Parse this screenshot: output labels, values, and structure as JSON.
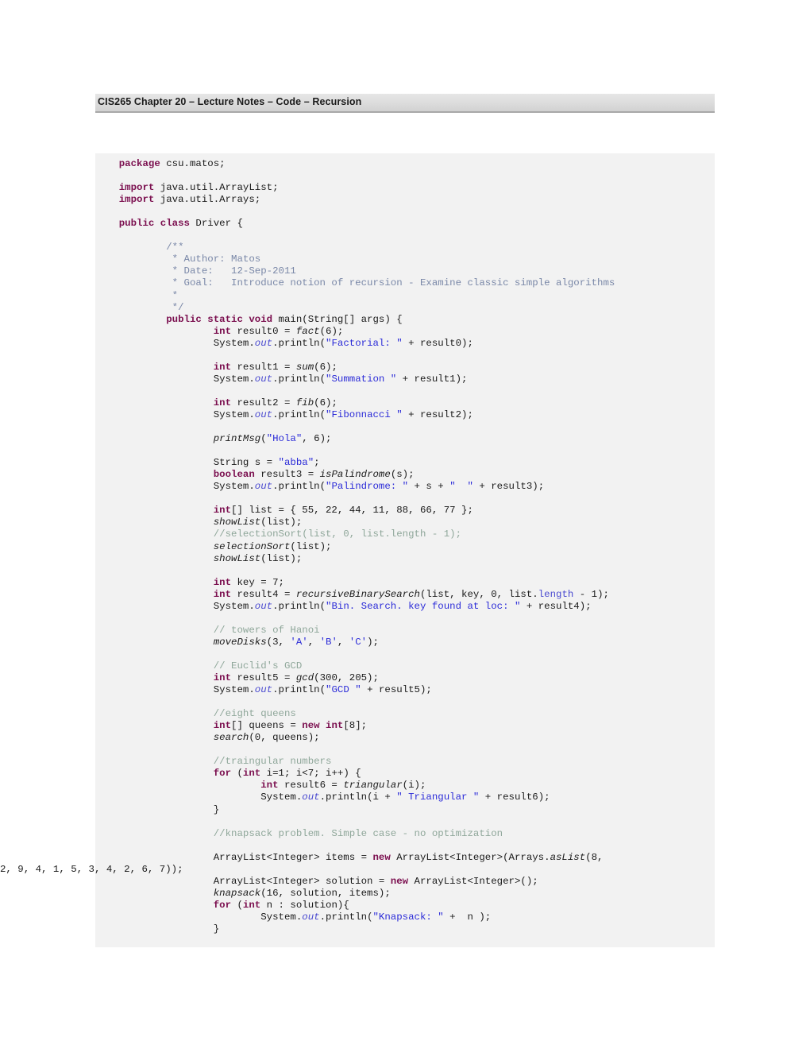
{
  "document": {
    "header": {
      "title": "CIS265  Chapter 20 – Lecture Notes – Code – Recursion"
    },
    "colors": {
      "page_background": "#ffffff",
      "header_background": "#dcdcdc",
      "header_border": "#a8a8a8",
      "code_background": "#f2f2f2",
      "keyword": "#7b0f4f",
      "string": "#2b2bd8",
      "line_comment": "#8fa79a",
      "javadoc_comment": "#7a88a8",
      "field": "#4a4ad0",
      "plain_text": "#1a1a1a"
    },
    "code": {
      "language": "java",
      "lines": [
        {
          "n": 1,
          "indent": 0,
          "tokens": [
            {
              "t": "package",
              "c": "kw"
            },
            {
              "t": " csu.matos;",
              "c": "id"
            }
          ]
        },
        {
          "n": 2,
          "indent": 0,
          "tokens": []
        },
        {
          "n": 3,
          "indent": 0,
          "tokens": [
            {
              "t": "import",
              "c": "kw"
            },
            {
              "t": " java.util.ArrayList;",
              "c": "id"
            }
          ]
        },
        {
          "n": 4,
          "indent": 0,
          "tokens": [
            {
              "t": "import",
              "c": "kw"
            },
            {
              "t": " java.util.Arrays;",
              "c": "id"
            }
          ]
        },
        {
          "n": 5,
          "indent": 0,
          "tokens": []
        },
        {
          "n": 6,
          "indent": 0,
          "tokens": [
            {
              "t": "public class",
              "c": "kw"
            },
            {
              "t": " Driver {",
              "c": "id"
            }
          ]
        },
        {
          "n": 7,
          "indent": 0,
          "tokens": []
        },
        {
          "n": 8,
          "indent": 1,
          "tokens": [
            {
              "t": "/**",
              "c": "jdoc"
            }
          ]
        },
        {
          "n": 9,
          "indent": 1,
          "tokens": [
            {
              "t": " * Author: Matos",
              "c": "jdoc"
            }
          ]
        },
        {
          "n": 10,
          "indent": 1,
          "tokens": [
            {
              "t": " * Date:   12-Sep-2011",
              "c": "jdoc"
            }
          ]
        },
        {
          "n": 11,
          "indent": 1,
          "tokens": [
            {
              "t": " * Goal:   Introduce notion of recursion - Examine classic simple algorithms",
              "c": "jdoc"
            }
          ]
        },
        {
          "n": 12,
          "indent": 1,
          "tokens": [
            {
              "t": " *",
              "c": "jdoc"
            }
          ]
        },
        {
          "n": 13,
          "indent": 1,
          "tokens": [
            {
              "t": " */",
              "c": "jdoc"
            }
          ]
        },
        {
          "n": 14,
          "indent": 1,
          "tokens": [
            {
              "t": "public static void",
              "c": "kw"
            },
            {
              "t": " main(String[] args) {",
              "c": "id"
            }
          ]
        },
        {
          "n": 15,
          "indent": 2,
          "tokens": [
            {
              "t": "int",
              "c": "kw"
            },
            {
              "t": " result0 = ",
              "c": "id"
            },
            {
              "t": "fact",
              "c": "mth"
            },
            {
              "t": "(6);",
              "c": "id"
            }
          ]
        },
        {
          "n": 16,
          "indent": 2,
          "tokens": [
            {
              "t": "System.",
              "c": "id"
            },
            {
              "t": "out",
              "c": "fldi"
            },
            {
              "t": ".println(",
              "c": "id"
            },
            {
              "t": "\"Factorial: \"",
              "c": "str"
            },
            {
              "t": " + result0);",
              "c": "id"
            }
          ]
        },
        {
          "n": 17,
          "indent": 2,
          "tokens": []
        },
        {
          "n": 18,
          "indent": 2,
          "tokens": [
            {
              "t": "int",
              "c": "kw"
            },
            {
              "t": " result1 = ",
              "c": "id"
            },
            {
              "t": "sum",
              "c": "mth"
            },
            {
              "t": "(6);",
              "c": "id"
            }
          ]
        },
        {
          "n": 19,
          "indent": 2,
          "tokens": [
            {
              "t": "System.",
              "c": "id"
            },
            {
              "t": "out",
              "c": "fldi"
            },
            {
              "t": ".println(",
              "c": "id"
            },
            {
              "t": "\"Summation \"",
              "c": "str"
            },
            {
              "t": " + result1);",
              "c": "id"
            }
          ]
        },
        {
          "n": 20,
          "indent": 2,
          "tokens": []
        },
        {
          "n": 21,
          "indent": 2,
          "tokens": [
            {
              "t": "int",
              "c": "kw"
            },
            {
              "t": " result2 = ",
              "c": "id"
            },
            {
              "t": "fib",
              "c": "mth"
            },
            {
              "t": "(6);",
              "c": "id"
            }
          ]
        },
        {
          "n": 22,
          "indent": 2,
          "tokens": [
            {
              "t": "System.",
              "c": "id"
            },
            {
              "t": "out",
              "c": "fldi"
            },
            {
              "t": ".println(",
              "c": "id"
            },
            {
              "t": "\"Fibonnacci \"",
              "c": "str"
            },
            {
              "t": " + result2);",
              "c": "id"
            }
          ]
        },
        {
          "n": 23,
          "indent": 2,
          "tokens": []
        },
        {
          "n": 24,
          "indent": 2,
          "tokens": [
            {
              "t": "printMsg",
              "c": "mth"
            },
            {
              "t": "(",
              "c": "id"
            },
            {
              "t": "\"Hola\"",
              "c": "str"
            },
            {
              "t": ", 6);",
              "c": "id"
            }
          ]
        },
        {
          "n": 25,
          "indent": 2,
          "tokens": []
        },
        {
          "n": 26,
          "indent": 2,
          "tokens": [
            {
              "t": "String s = ",
              "c": "id"
            },
            {
              "t": "\"abba\"",
              "c": "str"
            },
            {
              "t": ";",
              "c": "id"
            }
          ]
        },
        {
          "n": 27,
          "indent": 2,
          "tokens": [
            {
              "t": "boolean",
              "c": "kw"
            },
            {
              "t": " result3 = ",
              "c": "id"
            },
            {
              "t": "isPalindrome",
              "c": "mth"
            },
            {
              "t": "(s);",
              "c": "id"
            }
          ]
        },
        {
          "n": 28,
          "indent": 2,
          "tokens": [
            {
              "t": "System.",
              "c": "id"
            },
            {
              "t": "out",
              "c": "fldi"
            },
            {
              "t": ".println(",
              "c": "id"
            },
            {
              "t": "\"Palindrome: \"",
              "c": "str"
            },
            {
              "t": " + s + ",
              "c": "id"
            },
            {
              "t": "\"  \"",
              "c": "str"
            },
            {
              "t": " + result3);",
              "c": "id"
            }
          ]
        },
        {
          "n": 29,
          "indent": 2,
          "tokens": []
        },
        {
          "n": 30,
          "indent": 2,
          "tokens": [
            {
              "t": "int",
              "c": "kw"
            },
            {
              "t": "[] list = { 55, 22, 44, 11, 88, 66, 77 };",
              "c": "id"
            }
          ]
        },
        {
          "n": 31,
          "indent": 2,
          "tokens": [
            {
              "t": "showList",
              "c": "mth"
            },
            {
              "t": "(list);",
              "c": "id"
            }
          ]
        },
        {
          "n": 32,
          "indent": 2,
          "tokens": [
            {
              "t": "//selectionSort(list, 0, list.length - 1);",
              "c": "cmt"
            }
          ]
        },
        {
          "n": 33,
          "indent": 2,
          "tokens": [
            {
              "t": "selectionSort",
              "c": "mth"
            },
            {
              "t": "(list);",
              "c": "id"
            }
          ]
        },
        {
          "n": 34,
          "indent": 2,
          "tokens": [
            {
              "t": "showList",
              "c": "mth"
            },
            {
              "t": "(list);",
              "c": "id"
            }
          ]
        },
        {
          "n": 35,
          "indent": 2,
          "tokens": []
        },
        {
          "n": 36,
          "indent": 2,
          "tokens": [
            {
              "t": "int",
              "c": "kw"
            },
            {
              "t": " key = 7;",
              "c": "id"
            }
          ]
        },
        {
          "n": 37,
          "indent": 2,
          "tokens": [
            {
              "t": "int",
              "c": "kw"
            },
            {
              "t": " result4 = ",
              "c": "id"
            },
            {
              "t": "recursiveBinarySearch",
              "c": "mth"
            },
            {
              "t": "(list, key, 0, list.",
              "c": "id"
            },
            {
              "t": "length",
              "c": "fld"
            },
            {
              "t": " - 1);",
              "c": "id"
            }
          ]
        },
        {
          "n": 38,
          "indent": 2,
          "tokens": [
            {
              "t": "System.",
              "c": "id"
            },
            {
              "t": "out",
              "c": "fldi"
            },
            {
              "t": ".println(",
              "c": "id"
            },
            {
              "t": "\"Bin. Search. key found at loc: \"",
              "c": "str"
            },
            {
              "t": " + result4);",
              "c": "id"
            }
          ]
        },
        {
          "n": 39,
          "indent": 2,
          "tokens": []
        },
        {
          "n": 40,
          "indent": 2,
          "tokens": [
            {
              "t": "// towers of Hanoi",
              "c": "cmt"
            }
          ]
        },
        {
          "n": 41,
          "indent": 2,
          "tokens": [
            {
              "t": "moveDisks",
              "c": "mth"
            },
            {
              "t": "(3, ",
              "c": "id"
            },
            {
              "t": "'A'",
              "c": "str"
            },
            {
              "t": ", ",
              "c": "id"
            },
            {
              "t": "'B'",
              "c": "str"
            },
            {
              "t": ", ",
              "c": "id"
            },
            {
              "t": "'C'",
              "c": "str"
            },
            {
              "t": ");",
              "c": "id"
            }
          ]
        },
        {
          "n": 42,
          "indent": 2,
          "tokens": []
        },
        {
          "n": 43,
          "indent": 2,
          "tokens": [
            {
              "t": "// Euclid's GCD",
              "c": "cmt"
            }
          ]
        },
        {
          "n": 44,
          "indent": 2,
          "tokens": [
            {
              "t": "int",
              "c": "kw"
            },
            {
              "t": " result5 = ",
              "c": "id"
            },
            {
              "t": "gcd",
              "c": "mth"
            },
            {
              "t": "(300, 205);",
              "c": "id"
            }
          ]
        },
        {
          "n": 45,
          "indent": 2,
          "tokens": [
            {
              "t": "System.",
              "c": "id"
            },
            {
              "t": "out",
              "c": "fldi"
            },
            {
              "t": ".println(",
              "c": "id"
            },
            {
              "t": "\"GCD \"",
              "c": "str"
            },
            {
              "t": " + result5);",
              "c": "id"
            }
          ]
        },
        {
          "n": 46,
          "indent": 2,
          "tokens": []
        },
        {
          "n": 47,
          "indent": 2,
          "tokens": [
            {
              "t": "//eight queens",
              "c": "cmt"
            }
          ]
        },
        {
          "n": 48,
          "indent": 2,
          "tokens": [
            {
              "t": "int",
              "c": "kw"
            },
            {
              "t": "[] queens = ",
              "c": "id"
            },
            {
              "t": "new int",
              "c": "kw"
            },
            {
              "t": "[8];",
              "c": "id"
            }
          ]
        },
        {
          "n": 49,
          "indent": 2,
          "tokens": [
            {
              "t": "search",
              "c": "mth"
            },
            {
              "t": "(0, queens);",
              "c": "id"
            }
          ]
        },
        {
          "n": 50,
          "indent": 2,
          "tokens": []
        },
        {
          "n": 51,
          "indent": 2,
          "tokens": [
            {
              "t": "//traingular numbers",
              "c": "cmt"
            }
          ]
        },
        {
          "n": 52,
          "indent": 2,
          "tokens": [
            {
              "t": "for",
              "c": "kw"
            },
            {
              "t": " (",
              "c": "id"
            },
            {
              "t": "int",
              "c": "kw"
            },
            {
              "t": " i=1; i<7; i++) {",
              "c": "id"
            }
          ]
        },
        {
          "n": 53,
          "indent": 3,
          "tokens": [
            {
              "t": "int",
              "c": "kw"
            },
            {
              "t": " result6 = ",
              "c": "id"
            },
            {
              "t": "triangular",
              "c": "mth"
            },
            {
              "t": "(i);",
              "c": "id"
            }
          ]
        },
        {
          "n": 54,
          "indent": 3,
          "tokens": [
            {
              "t": "System.",
              "c": "id"
            },
            {
              "t": "out",
              "c": "fldi"
            },
            {
              "t": ".println(i + ",
              "c": "id"
            },
            {
              "t": "\" Triangular \"",
              "c": "str"
            },
            {
              "t": " + result6);",
              "c": "id"
            }
          ]
        },
        {
          "n": 55,
          "indent": 2,
          "tokens": [
            {
              "t": "}",
              "c": "id"
            }
          ]
        },
        {
          "n": 56,
          "indent": 2,
          "tokens": []
        },
        {
          "n": 57,
          "indent": 2,
          "tokens": [
            {
              "t": "//knapsack problem. Simple case - no optimization",
              "c": "cmt"
            }
          ]
        },
        {
          "n": 58,
          "indent": 2,
          "tokens": []
        },
        {
          "n": 59,
          "indent": 2,
          "wrap": true,
          "tokens": [
            {
              "t": "ArrayList<Integer> items = ",
              "c": "id"
            },
            {
              "t": "new",
              "c": "kw"
            },
            {
              "t": " ArrayList<Integer>(Arrays.",
              "c": "id"
            },
            {
              "t": "asList",
              "c": "mth"
            },
            {
              "t": "(8, 2, 9, 4, 1, 5, 3, 4, 2, 6, 7));",
              "c": "id"
            }
          ]
        },
        {
          "n": 60,
          "indent": 2,
          "tokens": [
            {
              "t": "ArrayList<Integer> solution = ",
              "c": "id"
            },
            {
              "t": "new",
              "c": "kw"
            },
            {
              "t": " ArrayList<Integer>();",
              "c": "id"
            }
          ]
        },
        {
          "n": 61,
          "indent": 2,
          "tokens": [
            {
              "t": "knapsack",
              "c": "mth"
            },
            {
              "t": "(16, solution, items);",
              "c": "id"
            }
          ]
        },
        {
          "n": 62,
          "indent": 2,
          "tokens": [
            {
              "t": "for",
              "c": "kw"
            },
            {
              "t": " (",
              "c": "id"
            },
            {
              "t": "int",
              "c": "kw"
            },
            {
              "t": " n : solution){",
              "c": "id"
            }
          ]
        },
        {
          "n": 63,
          "indent": 3,
          "tokens": [
            {
              "t": "System.",
              "c": "id"
            },
            {
              "t": "out",
              "c": "fldi"
            },
            {
              "t": ".println(",
              "c": "id"
            },
            {
              "t": "\"Knapsack: \"",
              "c": "str"
            },
            {
              "t": " +  n );",
              "c": "id"
            }
          ]
        },
        {
          "n": 64,
          "indent": 2,
          "tokens": [
            {
              "t": "}",
              "c": "id"
            }
          ]
        }
      ]
    }
  }
}
